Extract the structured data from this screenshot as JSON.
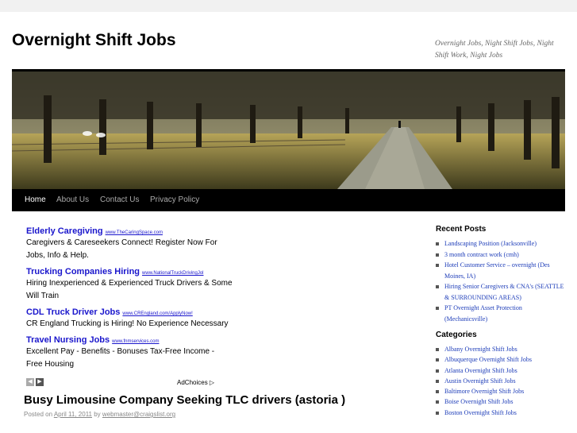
{
  "site": {
    "title": "Overnight Shift Jobs",
    "tagline": "Overnight Jobs, Night Shift Jobs, Night Shift Work, Night Jobs"
  },
  "nav": {
    "items": [
      "Home",
      "About Us",
      "Contact Us",
      "Privacy Policy"
    ],
    "active": "Home"
  },
  "ads": [
    {
      "title": "Elderly Caregiving",
      "url": "www.TheCaringSpace.com",
      "desc": "Caregivers & Careseekers Connect! Register Now For Jobs, Info & Help."
    },
    {
      "title": "Trucking Companies Hiring",
      "url": "www.NationalTruckDrivingJol",
      "desc": "Hiring Inexperienced & Experienced Truck Drivers & Some Will Train"
    },
    {
      "title": "CDL Truck Driver Jobs",
      "url": "www.CREngland.com/ApplyNow!",
      "desc": "CR England Trucking is Hiring! No Experience Necessary"
    },
    {
      "title": "Travel Nursing Jobs",
      "url": "www.fnmservices.com",
      "desc": "Excellent Pay - Benefits - Bonuses Tax-Free Income - Free Housing"
    }
  ],
  "adchoices": "AdChoices",
  "post": {
    "title": "Busy Limousine Company Seeking TLC drivers (astoria )",
    "posted_on": "Posted on",
    "date": "April 11, 2011",
    "by": "by",
    "author": "webmaster@craigslist.org"
  },
  "sidebar": {
    "recent_title": "Recent Posts",
    "recent_posts": [
      "Landscaping Position (Jacksonville)",
      "3 month contract work (cmh)",
      "Hotel Customer Service – overnight (Des Moines, IA)",
      "Hiring Senior Caregivers & CNA's (SEATTLE & SURROUNDING AREAS)",
      "PT Overnight Asset Protection (Mechanicsville)"
    ],
    "categories_title": "Categories",
    "categories": [
      "Albany Overnight Shift Jobs",
      "Albuquerque Overnight Shift Jobs",
      "Atlanta Overnight Shift Jobs",
      "Austin Overnight Shift Jobs",
      "Baltimore Overnight Shift Jobs",
      "Boise Overnight Shift Jobs",
      "Boston Overnight Shift Jobs"
    ]
  },
  "colors": {
    "link": "#1b3bb8",
    "ad_link": "#1a16cc",
    "nav_bg": "#000000"
  }
}
